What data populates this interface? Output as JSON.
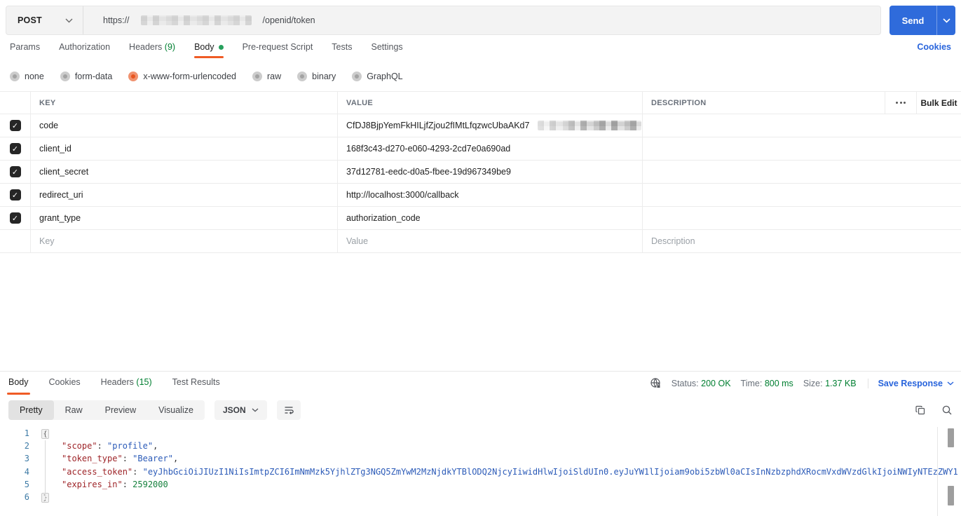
{
  "colors": {
    "accent_orange": "#ef5b25",
    "success_green": "#007f31",
    "link_blue": "#2864dc",
    "send_blue": "#2f6bdb",
    "code_key": "#9e2428",
    "code_string": "#2c5bb8",
    "code_number": "#15803d",
    "line_number": "#3e7ba6"
  },
  "icons": {
    "checkbox_check": "✓"
  },
  "request": {
    "method": "POST",
    "url_prefix": "https://",
    "url_suffix": "/openid/token",
    "send_label": "Send"
  },
  "request_tabs": {
    "params": "Params",
    "authorization": "Authorization",
    "headers": "Headers",
    "headers_count": "(9)",
    "body": "Body",
    "pre_request": "Pre-request Script",
    "tests": "Tests",
    "settings": "Settings",
    "cookies_link": "Cookies"
  },
  "body_modes": {
    "none": "none",
    "form_data": "form-data",
    "urlencoded": "x-www-form-urlencoded",
    "raw": "raw",
    "binary": "binary",
    "graphql": "GraphQL"
  },
  "params_table": {
    "header": {
      "key": "KEY",
      "value": "VALUE",
      "description": "DESCRIPTION",
      "bulk_edit": "Bulk Edit"
    },
    "rows": [
      {
        "key": "code",
        "value": "CfDJ8BjpYemFkHILjfZjou2fIMtLfqzwcUbaAKd7"
      },
      {
        "key": "client_id",
        "value": "168f3c43-d270-e060-4293-2cd7e0a690ad"
      },
      {
        "key": "client_secret",
        "value": "37d12781-eedc-d0a5-fbee-19d967349be9"
      },
      {
        "key": "redirect_uri",
        "value": "http://localhost:3000/callback"
      },
      {
        "key": "grant_type",
        "value": "authorization_code"
      }
    ],
    "placeholder": {
      "key": "Key",
      "value": "Value",
      "description": "Description"
    }
  },
  "response": {
    "tabs": {
      "body": "Body",
      "cookies": "Cookies",
      "headers": "Headers",
      "headers_count": "(15)",
      "test_results": "Test Results"
    },
    "meta": {
      "status_label": "Status:",
      "status_value": "200 OK",
      "time_label": "Time:",
      "time_value": "800 ms",
      "size_label": "Size:",
      "size_value": "1.37 KB",
      "save_response": "Save Response"
    },
    "toolbar": {
      "pretty": "Pretty",
      "raw": "Raw",
      "preview": "Preview",
      "visualize": "Visualize",
      "format": "JSON"
    },
    "code": {
      "line_numbers": [
        "1",
        "2",
        "3",
        "4",
        "5",
        "6"
      ],
      "lines": [
        {
          "brace": "{"
        },
        {
          "key": "\"scope\"",
          "sep": ": ",
          "value": "\"profile\"",
          "comma": ","
        },
        {
          "key": "\"token_type\"",
          "sep": ": ",
          "value": "\"Bearer\"",
          "comma": ","
        },
        {
          "key": "\"access_token\"",
          "sep": ": ",
          "value": "\"eyJhbGciOiJIUzI1NiIsImtpZCI6ImNmMzk5YjhlZTg3NGQ5ZmYwM2MzNjdkYTBlODQ2NjcyIiwidHlwIjoiSldUIn0.eyJuYW1lIjoiam9obi5zbWl0aCIsInNzbzphdXRocmVxdWVzdGlkIjoiNWIyNTEzZWY1"
        },
        {
          "key": "\"expires_in\"",
          "sep": ": ",
          "number": "2592000"
        },
        {
          "brace": "}"
        }
      ]
    }
  }
}
